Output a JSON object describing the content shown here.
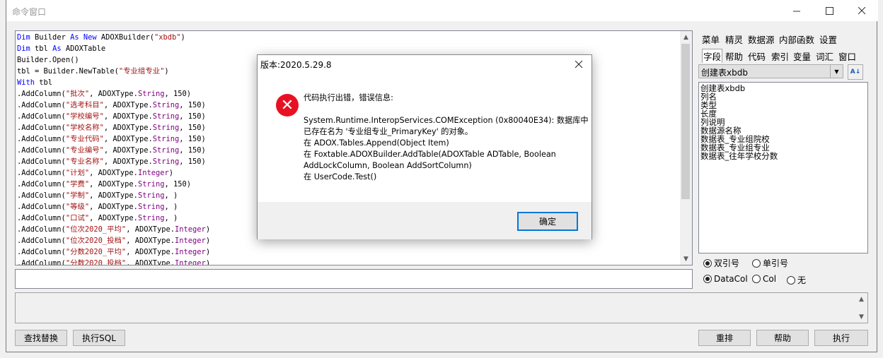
{
  "window": {
    "title": "命令窗口"
  },
  "editor": {
    "lines": [
      [
        {
          "t": "Dim",
          "c": "kw"
        },
        {
          "t": " Builder ",
          "c": ""
        },
        {
          "t": "As New",
          "c": "kw"
        },
        {
          "t": " ADOXBuilder(",
          "c": ""
        },
        {
          "t": "\"xbdb\"",
          "c": "str"
        },
        {
          "t": ")",
          "c": ""
        }
      ],
      [
        {
          "t": "Dim",
          "c": "kw"
        },
        {
          "t": " tbl ",
          "c": ""
        },
        {
          "t": "As",
          "c": "kw"
        },
        {
          "t": " ADOXTable",
          "c": ""
        }
      ],
      [
        {
          "t": "Builder.Open()",
          "c": ""
        }
      ],
      [
        {
          "t": "tbl = Builder.NewTable(",
          "c": ""
        },
        {
          "t": "\"专业组专业\"",
          "c": "str"
        },
        {
          "t": ")",
          "c": ""
        }
      ],
      [
        {
          "t": "With",
          "c": "kw"
        },
        {
          "t": " tbl",
          "c": ""
        }
      ],
      [
        {
          "t": ".AddColumn(",
          "c": ""
        },
        {
          "t": "\"批次\"",
          "c": "str"
        },
        {
          "t": ", ADOXType.",
          "c": ""
        },
        {
          "t": "String",
          "c": "ty"
        },
        {
          "t": ", 150)",
          "c": ""
        }
      ],
      [
        {
          "t": ".AddColumn(",
          "c": ""
        },
        {
          "t": "\"选考科目\"",
          "c": "str"
        },
        {
          "t": ", ADOXType.",
          "c": ""
        },
        {
          "t": "String",
          "c": "ty"
        },
        {
          "t": ", 150)",
          "c": ""
        }
      ],
      [
        {
          "t": ".AddColumn(",
          "c": ""
        },
        {
          "t": "\"学校编号\"",
          "c": "str"
        },
        {
          "t": ", ADOXType.",
          "c": ""
        },
        {
          "t": "String",
          "c": "ty"
        },
        {
          "t": ", 150)",
          "c": ""
        }
      ],
      [
        {
          "t": ".AddColumn(",
          "c": ""
        },
        {
          "t": "\"学校名称\"",
          "c": "str"
        },
        {
          "t": ", ADOXType.",
          "c": ""
        },
        {
          "t": "String",
          "c": "ty"
        },
        {
          "t": ", 150)",
          "c": ""
        }
      ],
      [
        {
          "t": ".AddColumn(",
          "c": ""
        },
        {
          "t": "\"专业代码\"",
          "c": "str"
        },
        {
          "t": ", ADOXType.",
          "c": ""
        },
        {
          "t": "String",
          "c": "ty"
        },
        {
          "t": ", 150)",
          "c": ""
        }
      ],
      [
        {
          "t": ".AddColumn(",
          "c": ""
        },
        {
          "t": "\"专业编号\"",
          "c": "str"
        },
        {
          "t": ", ADOXType.",
          "c": ""
        },
        {
          "t": "String",
          "c": "ty"
        },
        {
          "t": ", 150)",
          "c": ""
        }
      ],
      [
        {
          "t": ".AddColumn(",
          "c": ""
        },
        {
          "t": "\"专业名称\"",
          "c": "str"
        },
        {
          "t": ", ADOXType.",
          "c": ""
        },
        {
          "t": "String",
          "c": "ty"
        },
        {
          "t": ", 150)",
          "c": ""
        }
      ],
      [
        {
          "t": ".AddColumn(",
          "c": ""
        },
        {
          "t": "\"计划\"",
          "c": "str"
        },
        {
          "t": ", ADOXType.",
          "c": ""
        },
        {
          "t": "Integer",
          "c": "ty"
        },
        {
          "t": ")",
          "c": ""
        }
      ],
      [
        {
          "t": ".AddColumn(",
          "c": ""
        },
        {
          "t": "\"学费\"",
          "c": "str"
        },
        {
          "t": ", ADOXType.",
          "c": ""
        },
        {
          "t": "String",
          "c": "ty"
        },
        {
          "t": ", 150)",
          "c": ""
        }
      ],
      [
        {
          "t": ".AddColumn(",
          "c": ""
        },
        {
          "t": "\"学制\"",
          "c": "str"
        },
        {
          "t": ", ADOXType.",
          "c": ""
        },
        {
          "t": "String",
          "c": "ty"
        },
        {
          "t": ", )",
          "c": ""
        }
      ],
      [
        {
          "t": ".AddColumn(",
          "c": ""
        },
        {
          "t": "\"等级\"",
          "c": "str"
        },
        {
          "t": ", ADOXType.",
          "c": ""
        },
        {
          "t": "String",
          "c": "ty"
        },
        {
          "t": ", )",
          "c": ""
        }
      ],
      [
        {
          "t": ".AddColumn(",
          "c": ""
        },
        {
          "t": "\"口试\"",
          "c": "str"
        },
        {
          "t": ", ADOXType.",
          "c": ""
        },
        {
          "t": "String",
          "c": "ty"
        },
        {
          "t": ", )",
          "c": ""
        }
      ],
      [
        {
          "t": ".AddColumn(",
          "c": ""
        },
        {
          "t": "\"位次2020_平均\"",
          "c": "str"
        },
        {
          "t": ", ADOXType.",
          "c": ""
        },
        {
          "t": "Integer",
          "c": "ty"
        },
        {
          "t": ")",
          "c": ""
        }
      ],
      [
        {
          "t": ".AddColumn(",
          "c": ""
        },
        {
          "t": "\"位次2020_投档\"",
          "c": "str"
        },
        {
          "t": ", ADOXType.",
          "c": ""
        },
        {
          "t": "Integer",
          "c": "ty"
        },
        {
          "t": ")",
          "c": ""
        }
      ],
      [
        {
          "t": ".AddColumn(",
          "c": ""
        },
        {
          "t": "\"分数2020_平均\"",
          "c": "str"
        },
        {
          "t": ", ADOXType.",
          "c": ""
        },
        {
          "t": "Integer",
          "c": "ty"
        },
        {
          "t": ")",
          "c": ""
        }
      ],
      [
        {
          "t": ".AddColumn(",
          "c": ""
        },
        {
          "t": "\"分数2020_投档\"",
          "c": "str"
        },
        {
          "t": ", ADOXType.",
          "c": ""
        },
        {
          "t": "Integer",
          "c": "ty"
        },
        {
          "t": ")",
          "c": ""
        }
      ]
    ]
  },
  "bottom_buttons": {
    "find_replace": "查找替换",
    "exec_sql": "执行SQL",
    "rearrange": "重排",
    "help": "帮助",
    "execute": "执行"
  },
  "right_panel": {
    "tabs_row1": [
      "菜单",
      "精灵",
      "数据源",
      "内部函数",
      "设置"
    ],
    "tabs_row2": [
      "字段",
      "帮助",
      "代码",
      "索引",
      "变量",
      "词汇",
      "窗口"
    ],
    "combo_value": "创建表xbdb",
    "field_items": [
      "创建表xbdb",
      "列名",
      "类型",
      "长度",
      "列说明",
      "数据源名称",
      "数据表_专业组院校",
      "数据表_专业组专业",
      "数据表_往年学校分数"
    ],
    "radio_row1": [
      {
        "label": "双引号",
        "checked": true
      },
      {
        "label": "单引号",
        "checked": false
      }
    ],
    "radio_row2": [
      {
        "label": "DataCol",
        "checked": true
      },
      {
        "label": "Col",
        "checked": false
      },
      {
        "label": "无",
        "checked": false
      }
    ]
  },
  "dialog": {
    "title": "版本:2020.5.29.8",
    "message_lines": [
      "代码执行出错，错误信息:",
      "",
      "System.Runtime.InteropServices.COMException (0x80040E34): 数据库中",
      "已存在名为 '专业组专业_PrimaryKey' 的对象。",
      "   在 ADOX.Tables.Append(Object Item)",
      "   在 Foxtable.ADOXBuilder.AddTable(ADOXTable ADTable, Boolean",
      "AddLockColumn, Boolean AddSortColumn)",
      "   在 UserCode.Test()"
    ],
    "ok_label": "确定"
  }
}
